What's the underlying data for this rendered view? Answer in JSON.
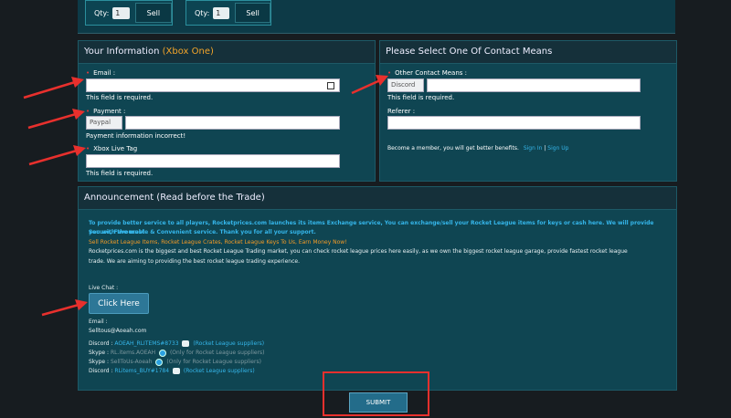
{
  "topbar": {
    "qty_label": "Qty:",
    "qty_value_1": "1",
    "qty_value_2": "1",
    "sell_label": "Sell"
  },
  "your_info": {
    "title": "Your Information",
    "platform": "(Xbox One)",
    "email_label": "Email :",
    "email_error": "This field is required.",
    "payment_label": "Payment :",
    "payment_method": "Paypal",
    "payment_error": "Payment information incorrect!",
    "gamertag_label": "Xbox Live Tag",
    "gamertag_error": "This field is required."
  },
  "contact": {
    "title": "Please Select One Of Contact Means",
    "other_label": "Other Contact Means :",
    "other_method": "Discord",
    "other_error": "This field is required.",
    "referer_label": "Referer :",
    "member_text": "Become a member, you will get better benefits.",
    "sign_in": "Sign In",
    "sep": "|",
    "sign_up": "Sign Up"
  },
  "announcement": {
    "title": "Announcement (Read before the Trade)",
    "intro_1": "To provide better service to all players, Rocketprices.com launches its items Exchange service, You can exchange/sell your Rocket League items for keys or cash here. We will provide you with the most",
    "intro_2": "Secure, Favourable & Convenient service. Thank you for all your support.",
    "promo": "Sell Rocket League Items, Rocket League Crates, Rocket League Keys To Us, Earn Money Now!",
    "about_1": "Rocketprices.com is the biggest and best Rocket League Trading market, you can check rocket league prices here easily, as we own the biggest rocket league garage, provide fastest rocket league",
    "about_2": "trade. We are aiming to providing the best rocket league trading experience.",
    "live_chat_label": "Live Chat :",
    "click_here": "Click Here",
    "email_label": "Email :",
    "email_value": "Selltous@Aoeah.com",
    "discord1_label": "Discord :",
    "discord1_value": "AOEAH_RLITEMS#8733",
    "discord1_note": "(Rocket League suppliers)",
    "skype1_label": "Skype :",
    "skype1_value": "RL.items.AOEAH",
    "skype1_note": "(Only for Rocket League suppliers)",
    "skype2_label": "Skype :",
    "skype2_value": "SellToUs-Aoeah",
    "skype2_note": "(Only for Rocket League suppliers)",
    "discord2_label": "Discord :",
    "discord2_value": "RLitems_BUY#1784",
    "discord2_note": "(Rocket League suppliers)"
  },
  "submit_label": "SUBMIT",
  "colors": {
    "annotation_red": "#e8302d",
    "link_blue": "#35b6ea",
    "promo_orange": "#f39a27",
    "panel_teal": "#0f4552"
  }
}
